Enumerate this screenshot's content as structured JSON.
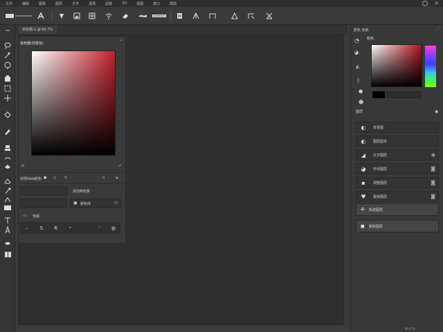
{
  "menubar": {
    "items": [
      "文件",
      "编辑",
      "图像",
      "图层",
      "文字",
      "选择",
      "滤镜",
      "3D",
      "视图",
      "窗口",
      "帮助"
    ]
  },
  "doc_tab": {
    "label": "未标题-1 @ 66.7%"
  },
  "color_picker": {
    "title": "拾色器(前景色)",
    "mode_label": "仅限Web颜色",
    "add_swatch_label": "添加到色板",
    "color_libraries_label": "颜色库",
    "hex_label": "色版"
  },
  "right_panel": {
    "header": "颜色 色板",
    "swatch_label": "颜色",
    "layers_header": "图层",
    "layers": [
      {
        "name": "背景图"
      },
      {
        "name": "图层副本"
      },
      {
        "name": "文字图层"
      },
      {
        "name": "形状图层"
      },
      {
        "name": "调整图层"
      },
      {
        "name": "蒙版图层"
      }
    ],
    "actions": [
      {
        "name": "新建图层"
      },
      {
        "name": "删除图层"
      }
    ]
  },
  "footer": {
    "label": "66.67%"
  },
  "colors": {
    "accent": "#c4202a",
    "panel_bg": "#3a3a3a",
    "canvas": "#2f2f2f"
  }
}
